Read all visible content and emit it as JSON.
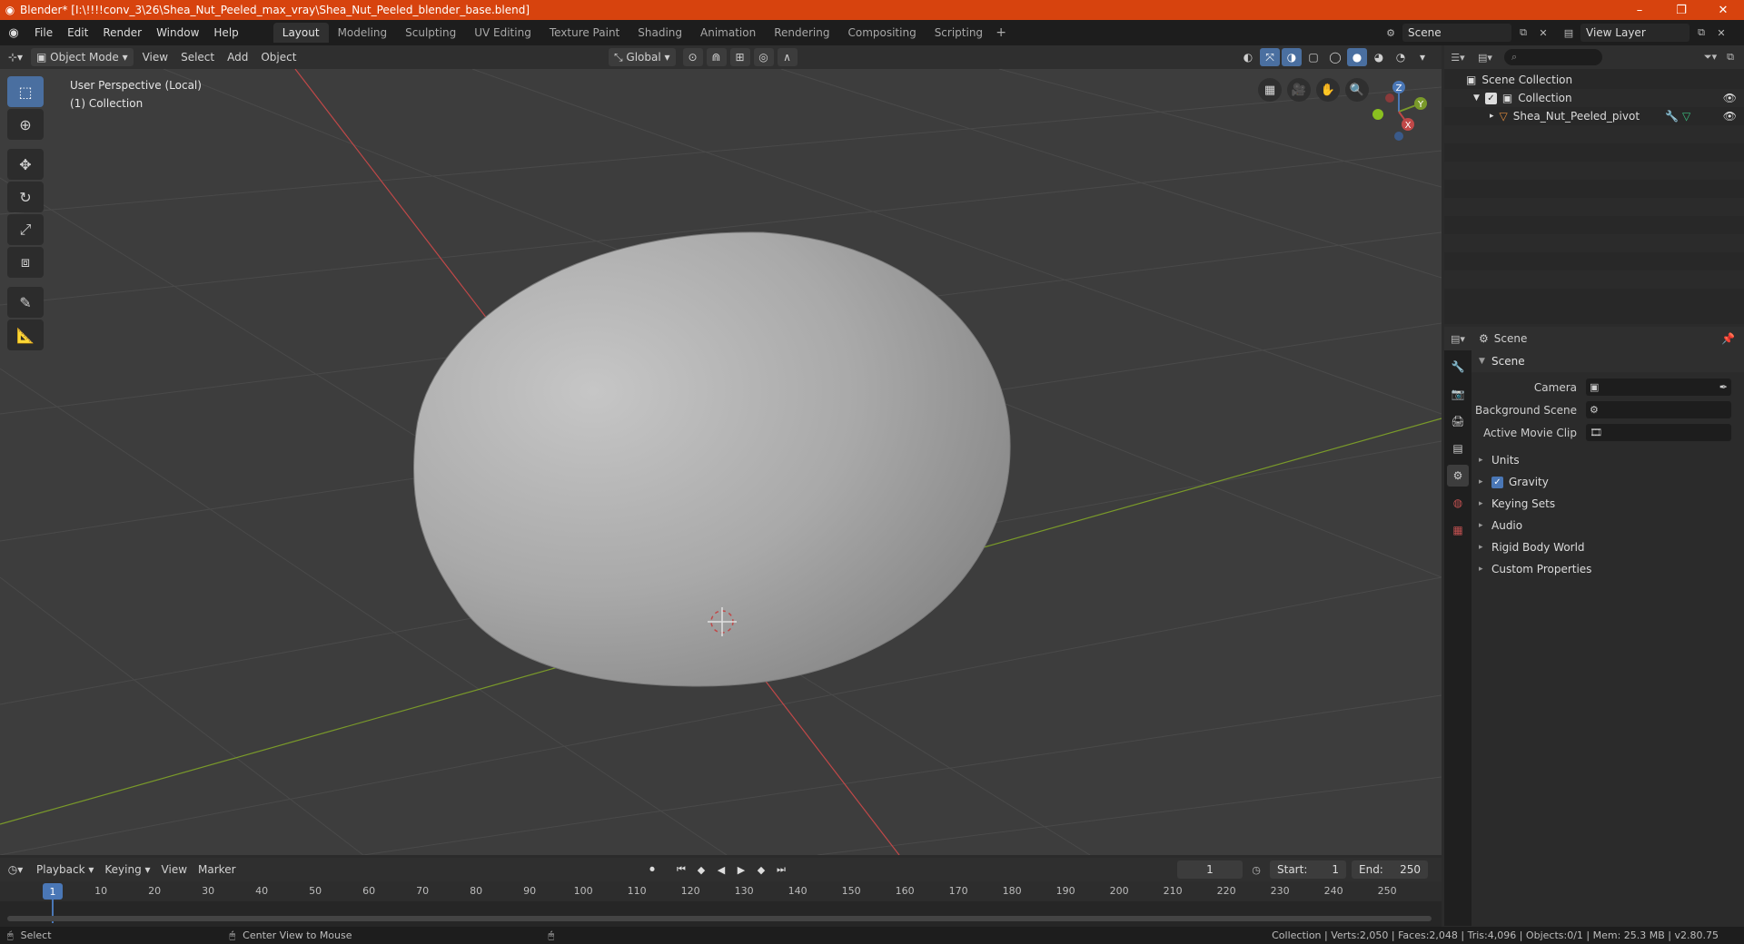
{
  "window": {
    "title": "Blender* [I:\\!!!!conv_3\\26\\Shea_Nut_Peeled_max_vray\\Shea_Nut_Peeled_blender_base.blend]",
    "minimize": "–",
    "maximize": "❐",
    "close": "✕"
  },
  "menu": [
    "File",
    "Edit",
    "Render",
    "Window",
    "Help"
  ],
  "workspaces": [
    "Layout",
    "Modeling",
    "Sculpting",
    "UV Editing",
    "Texture Paint",
    "Shading",
    "Animation",
    "Rendering",
    "Compositing",
    "Scripting"
  ],
  "active_workspace": "Layout",
  "scene_name": "Scene",
  "view_layer": "View Layer",
  "viewport": {
    "mode": "Object Mode",
    "menus": [
      "View",
      "Select",
      "Add",
      "Object"
    ],
    "orientation": "Global",
    "perspective_label": "User Perspective (Local)",
    "collection_label": "(1) Collection"
  },
  "gizmo": {
    "x": "X",
    "y": "Y",
    "z": "Z"
  },
  "outliner": {
    "search_placeholder": "",
    "scene_collection": "Scene Collection",
    "collection": "Collection",
    "object": "Shea_Nut_Peeled_pivot"
  },
  "properties": {
    "header": "Scene",
    "panel": "Scene",
    "camera_label": "Camera",
    "background_scene_label": "Background Scene",
    "active_movie_clip_label": "Active Movie Clip",
    "subpanels": [
      "Units",
      "Gravity",
      "Keying Sets",
      "Audio",
      "Rigid Body World",
      "Custom Properties"
    ]
  },
  "timeline": {
    "menus": [
      "Playback",
      "Keying",
      "View",
      "Marker"
    ],
    "current_frame": "1",
    "start_label": "Start:",
    "start": "1",
    "end_label": "End:",
    "end": "250",
    "ruler": [
      1,
      10,
      20,
      30,
      40,
      50,
      60,
      70,
      80,
      90,
      100,
      110,
      120,
      130,
      140,
      150,
      160,
      170,
      180,
      190,
      200,
      210,
      220,
      230,
      240,
      250
    ]
  },
  "statusbar": {
    "select": "Select",
    "center_view": "Center View to Mouse",
    "stats": "Collection | Verts:2,050 | Faces:2,048 | Tris:4,096 | Objects:0/1 | Mem: 25.3 MB | v2.80.75"
  },
  "colors": {
    "accent": "#4a77b6",
    "titlebar": "#d7430e",
    "x_axis": "#c04848",
    "y_axis": "#7a9a2a"
  }
}
